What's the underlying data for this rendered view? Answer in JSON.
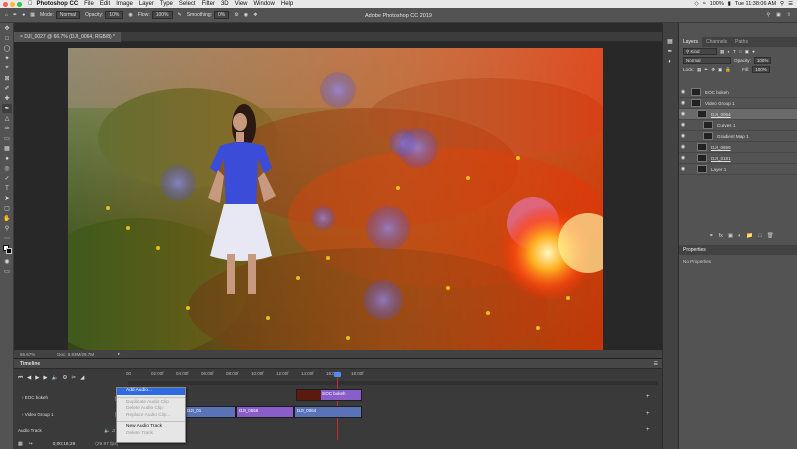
{
  "menubar": {
    "app": "Photoshop CC",
    "items": [
      "File",
      "Edit",
      "Image",
      "Layer",
      "Type",
      "Select",
      "Filter",
      "3D",
      "View",
      "Window",
      "Help"
    ],
    "battery": "100%",
    "clock": "Tue 11:38:06 AM"
  },
  "window_title": "Adobe Photoshop CC 2019",
  "options_bar": {
    "mode_label": "Mode:",
    "mode_value": "Normal",
    "opacity_label": "Opacity:",
    "opacity_value": "10%",
    "flow_label": "Flow:",
    "flow_value": "100%",
    "smoothing_label": "Smoothing:",
    "smoothing_value": "0%"
  },
  "document_tab": "DJI_0027 @ 66.7% (DJI_0064, RGB/8) *",
  "status": {
    "zoom": "66.67%",
    "doc": "Doc: 5.93M/29.7M"
  },
  "timeline": {
    "title": "Timeline",
    "ruler": [
      "00",
      "02:00f",
      "04:00f",
      "06:00f",
      "08:00f",
      "10:00f",
      "12:00f",
      "14:00f",
      "16:00f",
      "18:00f"
    ],
    "tracks": [
      "EOC bokeh",
      "Video Group 1",
      "Audio Track"
    ],
    "timecode": "0;00;16;29",
    "fps": "(29.97 fps)",
    "clips": [
      {
        "label": "EOC bokeh"
      },
      {
        "label": "DJI_01"
      },
      {
        "label": "DJI_0656"
      },
      {
        "label": "DJI_0064"
      }
    ]
  },
  "context_menu": {
    "items": [
      {
        "label": "Add Audio...",
        "state": "selected"
      },
      {
        "label": "Duplicate Audio Clip",
        "state": "disabled"
      },
      {
        "label": "Delete Audio Clip",
        "state": "disabled"
      },
      {
        "label": "Replace Audio Clip...",
        "state": "disabled"
      },
      {
        "label": "New Audio Track",
        "state": "normal"
      },
      {
        "label": "Delete Track",
        "state": "disabled"
      }
    ]
  },
  "layers_panel": {
    "tabs": [
      "Layers",
      "Channels",
      "Paths"
    ],
    "kind_label": "Kind",
    "blend_mode": "Normal",
    "opacity_label": "Opacity:",
    "opacity_value": "100%",
    "lock_label": "Lock:",
    "fill_label": "Fill:",
    "fill_value": "100%",
    "layers": [
      {
        "name": "EOC bokeh",
        "indent": 0,
        "selected": false
      },
      {
        "name": "Video Group 1",
        "indent": 0,
        "selected": false
      },
      {
        "name": "DJI_0064",
        "indent": 1,
        "selected": true
      },
      {
        "name": "Curves 1",
        "indent": 2,
        "selected": false
      },
      {
        "name": "Gradient Map 1",
        "indent": 2,
        "selected": false
      },
      {
        "name": "DJI_0656",
        "indent": 1,
        "selected": false
      },
      {
        "name": "DJI_0181",
        "indent": 1,
        "selected": false
      },
      {
        "name": "Layer 1",
        "indent": 1,
        "selected": false
      }
    ]
  },
  "properties_panel": {
    "title": "Properties",
    "empty": "No Properties"
  },
  "colors": {
    "accent": "#2f6ae0",
    "clip_purple": "#8a5ec8",
    "clip_blue": "#5a73b8"
  }
}
